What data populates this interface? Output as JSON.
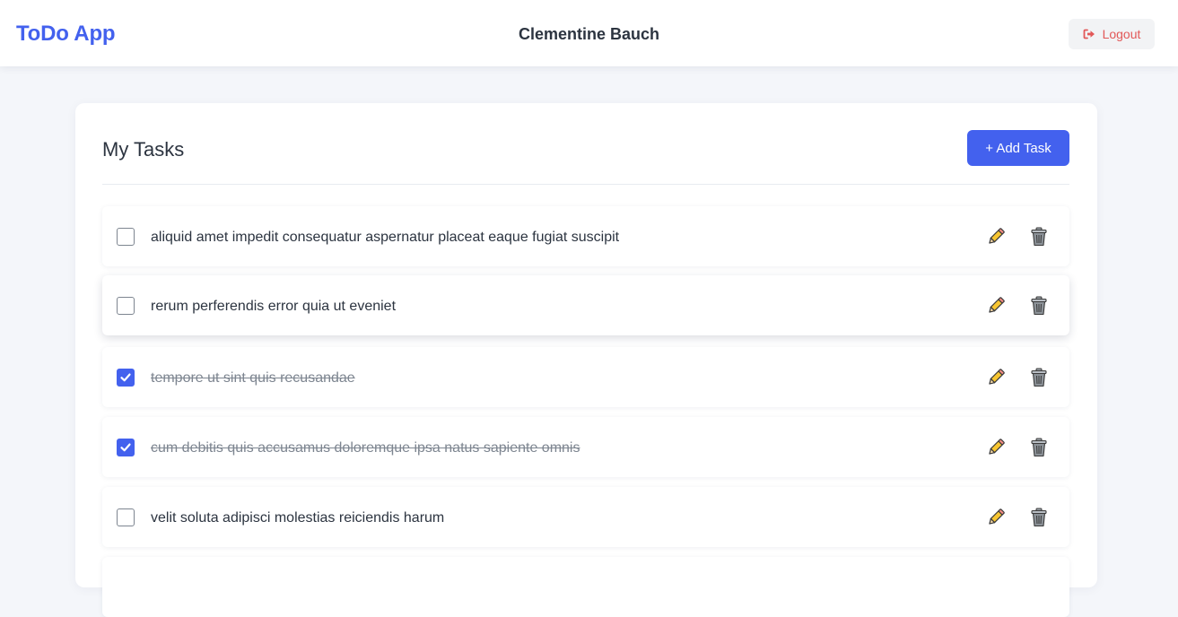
{
  "navbar": {
    "brand": "ToDo App",
    "username": "Clementine Bauch",
    "logout_label": "Logout",
    "logout_icon": "sign-out-icon"
  },
  "main": {
    "title": "My Tasks",
    "add_task_label": "+ Add Task",
    "tasks": [
      {
        "text": "aliquid amet impedit consequatur aspernatur placeat eaque fugiat suscipit",
        "completed": false
      },
      {
        "text": "rerum perferendis error quia ut eveniet",
        "completed": false
      },
      {
        "text": "tempore ut sint quis recusandae",
        "completed": true
      },
      {
        "text": "cum debitis quis accusamus doloremque ipsa natus sapiente omnis",
        "completed": true
      },
      {
        "text": "velit soluta adipisci molestias reiciendis harum",
        "completed": false
      }
    ],
    "edit_icon": "pencil-icon",
    "delete_icon": "trash-icon"
  },
  "colors": {
    "brand": "#4361ee",
    "logout_text": "#e25858",
    "background": "#f4f6fa"
  }
}
